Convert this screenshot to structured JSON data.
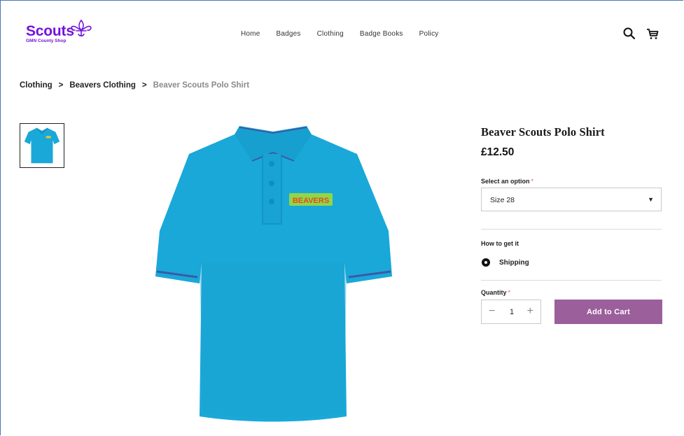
{
  "brand": {
    "name": "Scouts",
    "subtitle": "GMN County Shop",
    "color": "#7413dc"
  },
  "nav": {
    "items": [
      "Home",
      "Badges",
      "Clothing",
      "Badge Books",
      "Policy"
    ]
  },
  "header_icons": [
    "search-icon",
    "cart-icon"
  ],
  "breadcrumb": {
    "items": [
      "Clothing",
      "Beavers Clothing"
    ],
    "separator": ">",
    "current": "Beaver Scouts Polo Shirt"
  },
  "product": {
    "title": "Beaver Scouts Polo Shirt",
    "price": "£12.50",
    "badge_text": "BEAVERS",
    "shirt_color": "#1aa8d8",
    "option": {
      "label": "Select an option",
      "required_mark": "*",
      "selected": "Size 28"
    },
    "fulfilment": {
      "label": "How to get it",
      "selected": "Shipping"
    },
    "quantity": {
      "label": "Quantity",
      "required_mark": "*",
      "value": "1",
      "minus": "−",
      "plus": "+"
    },
    "add_to_cart_label": "Add to Cart",
    "button_color": "#9b5f9b"
  }
}
